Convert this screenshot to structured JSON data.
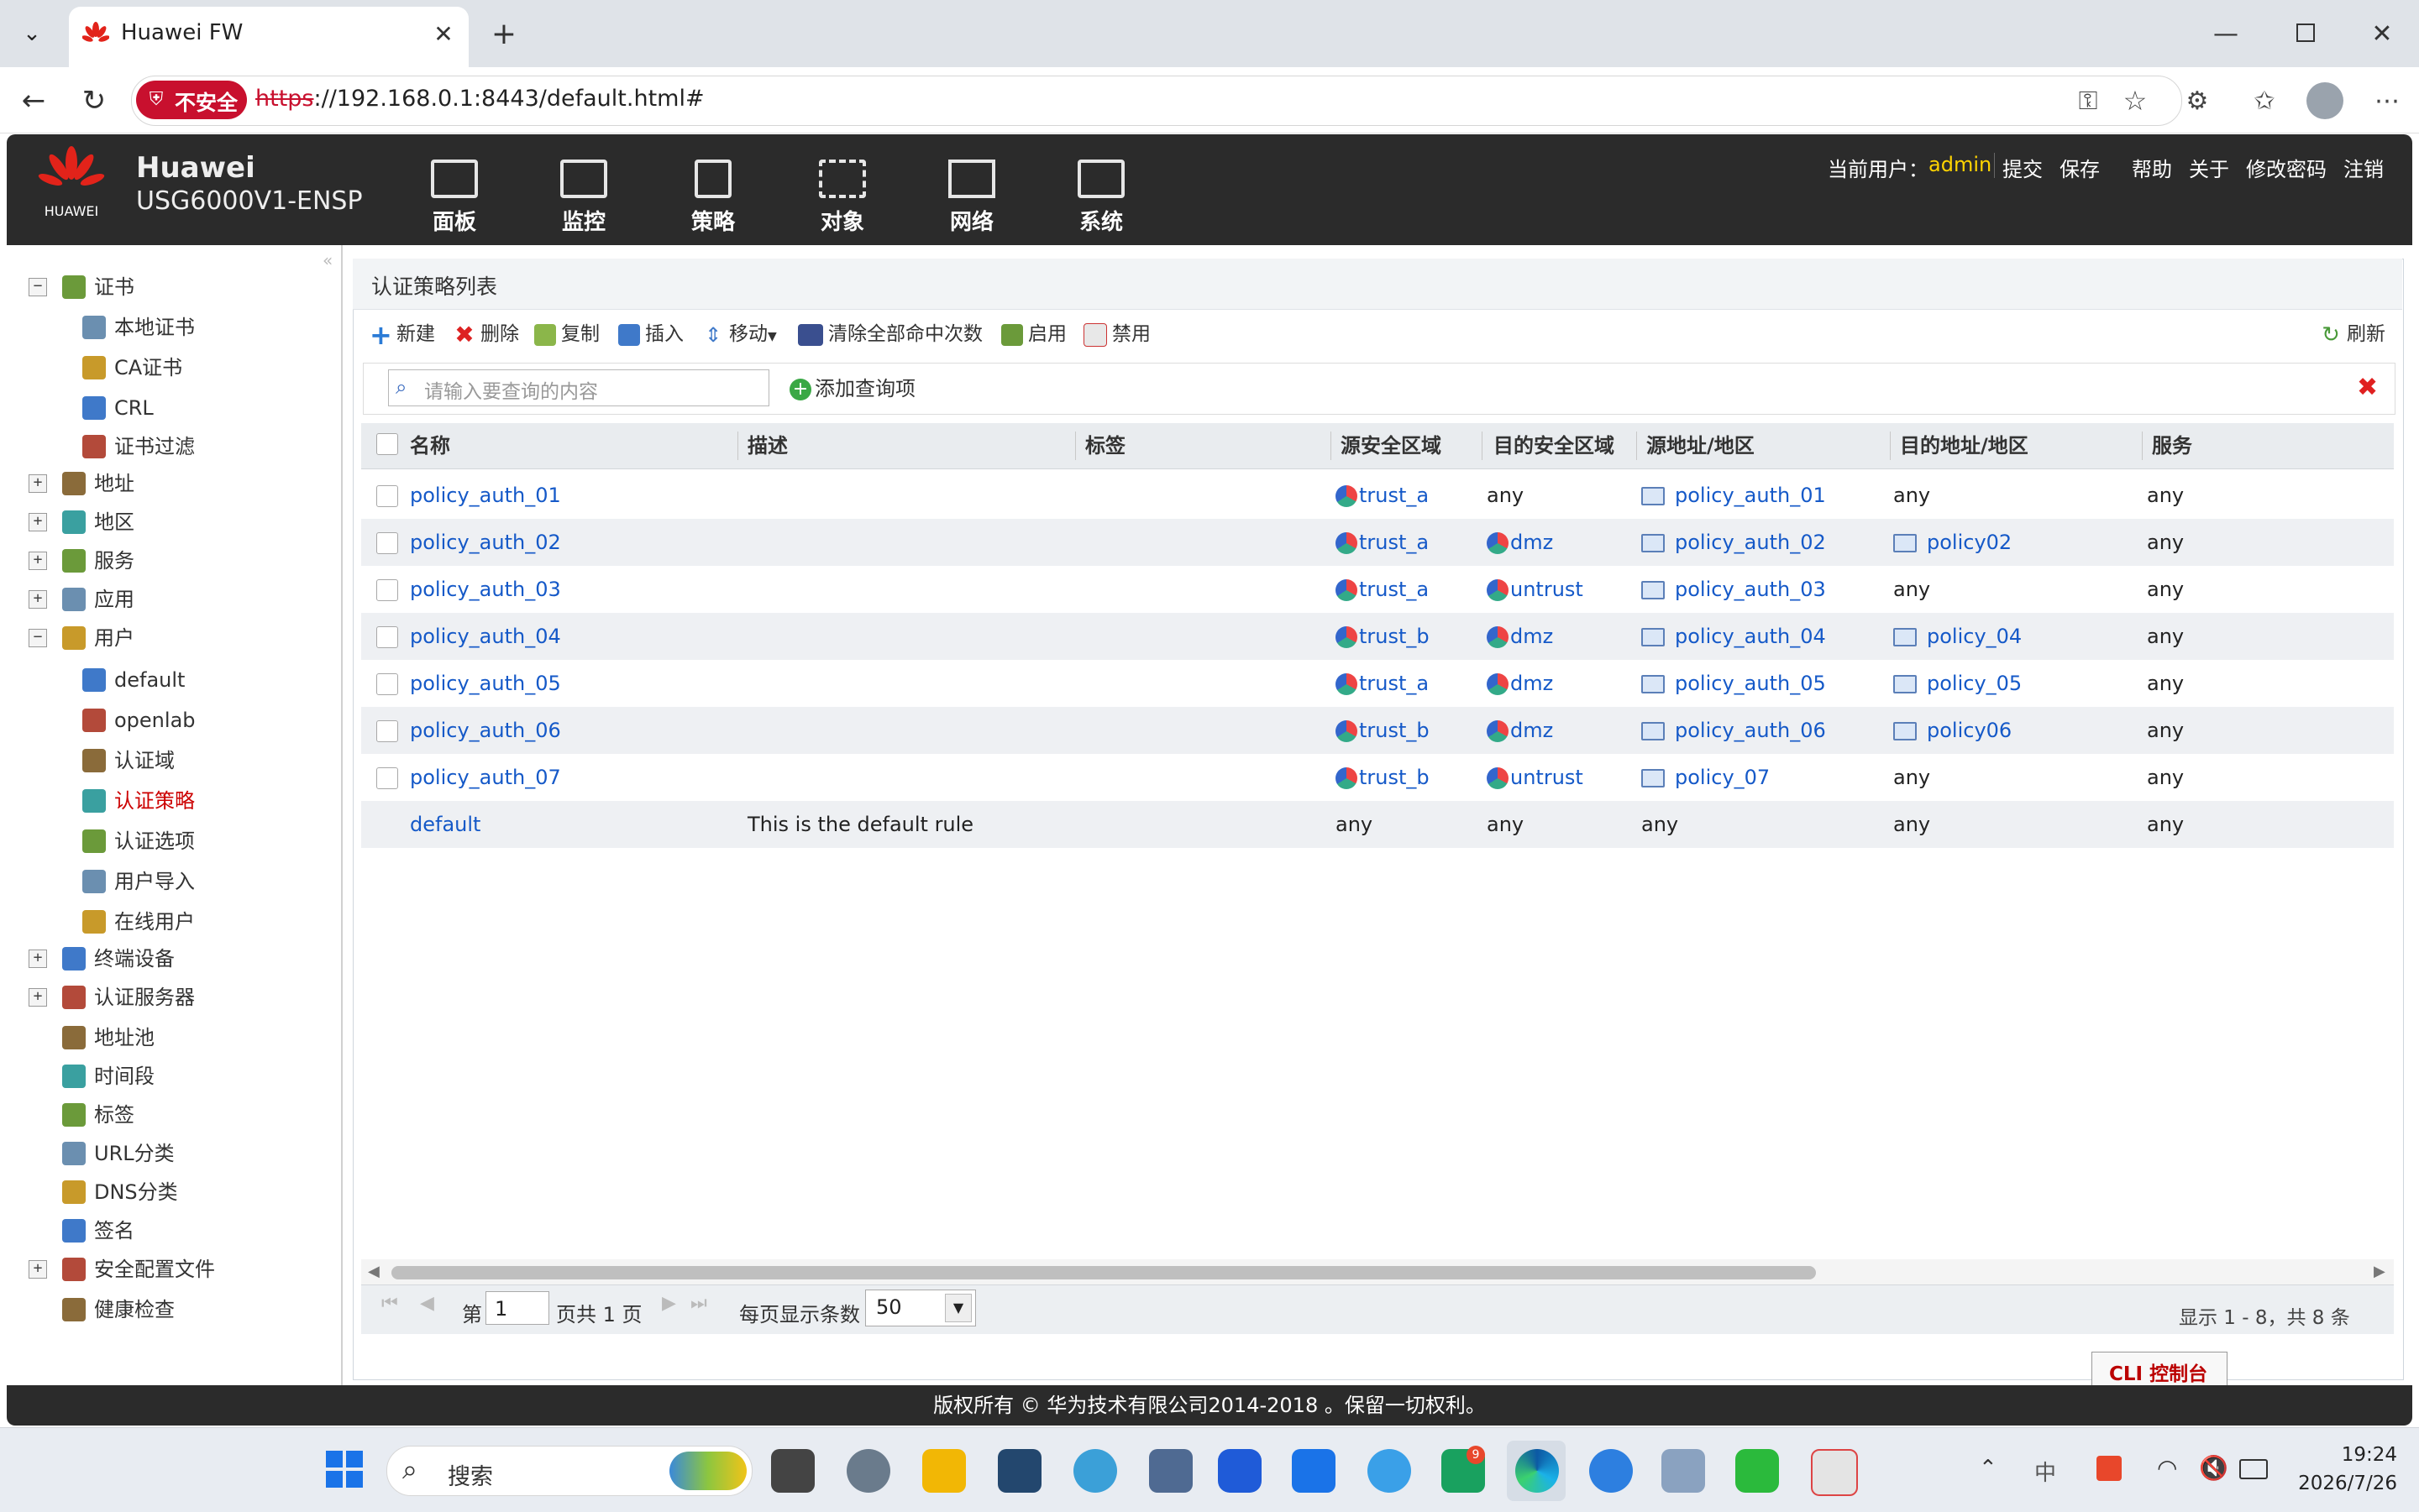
{
  "browser": {
    "tab_title": "Huawei FW",
    "security_label": "不安全",
    "url_scheme": "https",
    "url_rest": "://192.168.0.1:8443/default.html#",
    "icons": [
      "tab-list-icon",
      "huawei-logo-icon",
      "close-tab-icon",
      "new-tab-icon",
      "minimize-icon",
      "restore-icon",
      "close-window-icon",
      "back-icon",
      "refresh-icon",
      "key-icon",
      "star-icon",
      "extensions-icon",
      "favorites-icon",
      "profile-icon",
      "more-icon"
    ]
  },
  "header": {
    "brand": "HUAWEI",
    "product_line": "Huawei",
    "model": "USG6000V1-ENSP",
    "nav": [
      "面板",
      "监控",
      "策略",
      "对象",
      "网络",
      "系统"
    ],
    "current_user_label": "当前用户：",
    "current_user": "admin",
    "links": [
      "提交",
      "保存",
      "帮助",
      "关于",
      "修改密码",
      "注销"
    ]
  },
  "sidebar": {
    "items": [
      {
        "label": "证书",
        "level": 0,
        "expander": "−"
      },
      {
        "label": "本地证书",
        "level": 1
      },
      {
        "label": "CA证书",
        "level": 1
      },
      {
        "label": "CRL",
        "level": 1
      },
      {
        "label": "证书过滤",
        "level": 1
      },
      {
        "label": "地址",
        "level": 0,
        "expander": "+"
      },
      {
        "label": "地区",
        "level": 0,
        "expander": "+"
      },
      {
        "label": "服务",
        "level": 0,
        "expander": "+"
      },
      {
        "label": "应用",
        "level": 0,
        "expander": "+"
      },
      {
        "label": "用户",
        "level": 0,
        "expander": "−"
      },
      {
        "label": "default",
        "level": 1
      },
      {
        "label": "openlab",
        "level": 1
      },
      {
        "label": "认证域",
        "level": 1
      },
      {
        "label": "认证策略",
        "level": 1,
        "selected": true
      },
      {
        "label": "认证选项",
        "level": 1
      },
      {
        "label": "用户导入",
        "level": 1
      },
      {
        "label": "在线用户",
        "level": 1
      },
      {
        "label": "终端设备",
        "level": 0,
        "expander": "+"
      },
      {
        "label": "认证服务器",
        "level": 0,
        "expander": "+"
      },
      {
        "label": "地址池",
        "level": 0
      },
      {
        "label": "时间段",
        "level": 0
      },
      {
        "label": "标签",
        "level": 0
      },
      {
        "label": "URL分类",
        "level": 0
      },
      {
        "label": "DNS分类",
        "level": 0
      },
      {
        "label": "签名",
        "level": 0
      },
      {
        "label": "安全配置文件",
        "level": 0,
        "expander": "+"
      },
      {
        "label": "健康检查",
        "level": 0
      }
    ]
  },
  "panel": {
    "title": "认证策略列表",
    "toolbar": [
      "新建",
      "删除",
      "复制",
      "插入",
      "移动",
      "清除全部命中次数",
      "启用",
      "禁用"
    ],
    "refresh": "刷新",
    "search_placeholder": "请输入要查询的内容",
    "add_query": "添加查询项"
  },
  "table": {
    "columns": [
      "名称",
      "描述",
      "标签",
      "源安全区域",
      "目的安全区域",
      "源地址/地区",
      "目的地址/地区",
      "服务"
    ],
    "rows": [
      {
        "name": "policy_auth_01",
        "desc": "",
        "tag": "",
        "src_zone": "trust_a",
        "dst_zone": "any",
        "src_addr": "policy_auth_01",
        "dst_addr": "any",
        "service": "any"
      },
      {
        "name": "policy_auth_02",
        "desc": "",
        "tag": "",
        "src_zone": "trust_a",
        "dst_zone": "dmz",
        "src_addr": "policy_auth_02",
        "dst_addr": "policy02",
        "service": "any"
      },
      {
        "name": "policy_auth_03",
        "desc": "",
        "tag": "",
        "src_zone": "trust_a",
        "dst_zone": "untrust",
        "src_addr": "policy_auth_03",
        "dst_addr": "any",
        "service": "any"
      },
      {
        "name": "policy_auth_04",
        "desc": "",
        "tag": "",
        "src_zone": "trust_b",
        "dst_zone": "dmz",
        "src_addr": "policy_auth_04",
        "dst_addr": "policy_04",
        "service": "any"
      },
      {
        "name": "policy_auth_05",
        "desc": "",
        "tag": "",
        "src_zone": "trust_a",
        "dst_zone": "dmz",
        "src_addr": "policy_auth_05",
        "dst_addr": "policy_05",
        "service": "any"
      },
      {
        "name": "policy_auth_06",
        "desc": "",
        "tag": "",
        "src_zone": "trust_b",
        "dst_zone": "dmz",
        "src_addr": "policy_auth_06",
        "dst_addr": "policy06",
        "service": "any"
      },
      {
        "name": "policy_auth_07",
        "desc": "",
        "tag": "",
        "src_zone": "trust_b",
        "dst_zone": "untrust",
        "src_addr": "policy_07",
        "dst_addr": "any",
        "service": "any"
      },
      {
        "name": "default",
        "desc": "This is the default rule",
        "tag": "",
        "src_zone": "any",
        "dst_zone": "any",
        "src_addr": "any",
        "dst_addr": "any",
        "service": "any"
      }
    ]
  },
  "pager": {
    "page_prefix": "第",
    "page": "1",
    "page_suffix": "页共 1 页",
    "per_page_label": "每页显示条数",
    "per_page": "50",
    "summary": "显示 1 - 8，共 8 条"
  },
  "cli_button": "CLI 控制台",
  "copyright": "版权所有 © 华为技术有限公司2014-2018 。保留一切权利。",
  "taskbar": {
    "search_placeholder": "搜索",
    "ime": "中",
    "time": "19:24",
    "date": "2026/7/26",
    "badge": "9"
  },
  "colors": {
    "header_bg": "#2b2b2b",
    "link": "#1559c8",
    "selected": "#cc0000",
    "insecure": "#c8102e",
    "user": "#ffd400"
  }
}
